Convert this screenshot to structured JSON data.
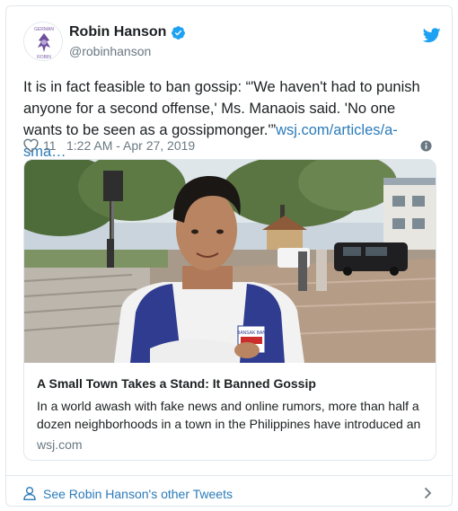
{
  "author": {
    "display_name": "Robin Hanson",
    "handle": "@robinhanson",
    "avatar_text_top": "GERMAN",
    "avatar_text_bottom": "ROBIN"
  },
  "tweet": {
    "text": "It is in fact feasible to ban gossip: “'We haven't had to punish anyone for a second offense,' Ms. Manaois said. 'No one wants to be seen as a gossipmonger.'”",
    "link": "wsj.com/articles/a-sma…",
    "like_count": "11",
    "timestamp": "1:22 AM - Apr 27, 2019"
  },
  "link_card": {
    "title": "A Small Town Takes a Stand: It Banned Gossip",
    "description": "In a world awash with fake news and online rumors, more than half a dozen neighborhoods in a town in the Philippines have introduced an",
    "domain": "wsj.com",
    "vest_badge_text": "BANSAK BAN"
  },
  "footer": {
    "link_label": "See Robin Hanson's other Tweets"
  },
  "colors": {
    "accent": "#2b7bb9",
    "twitter_blue": "#1da1f2",
    "secondary_text": "#697882",
    "border": "#e1e8ed"
  },
  "icons": [
    "verified-icon",
    "twitter-icon",
    "heart-icon",
    "info-icon",
    "person-icon",
    "chevron-right-icon"
  ]
}
